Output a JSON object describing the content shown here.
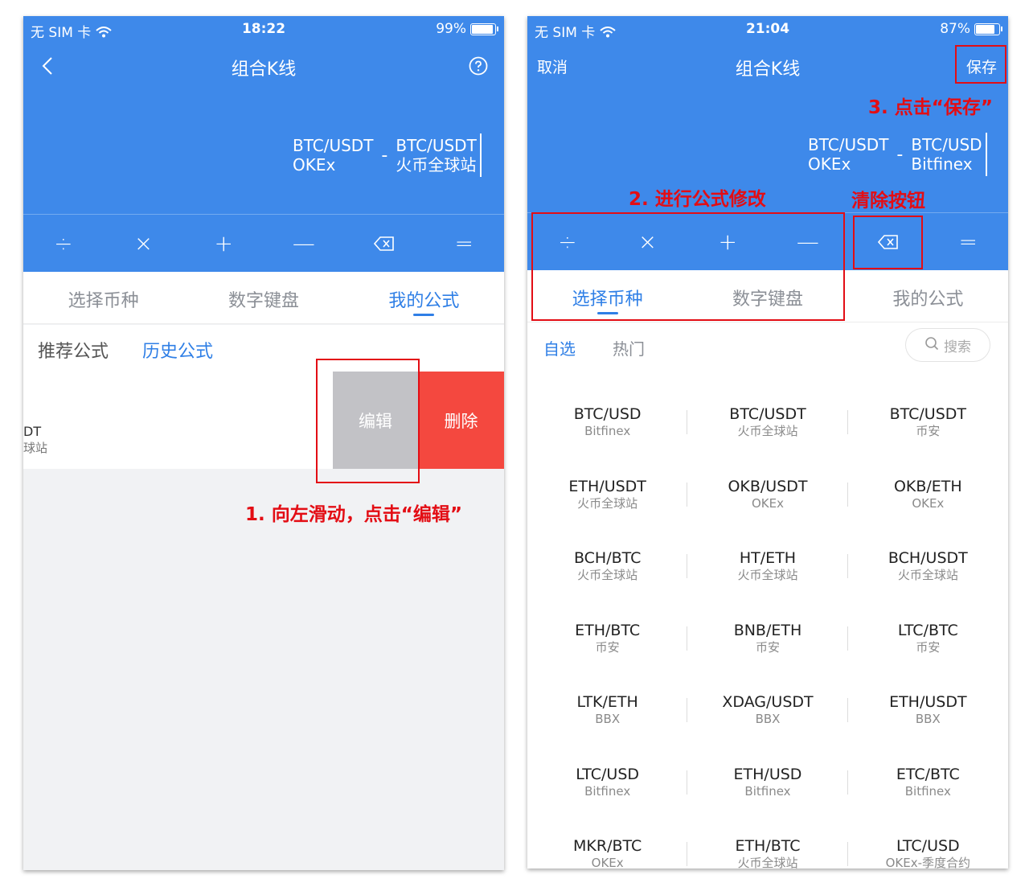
{
  "left": {
    "status": {
      "carrier": "无 SIM 卡",
      "time": "18:22",
      "battery": "99%",
      "battery_level": 0.99
    },
    "title": "组合K线",
    "pair_a": {
      "symbol": "BTC/USDT",
      "exchange": "OKEx"
    },
    "pair_b": {
      "symbol": "BTC/USDT",
      "exchange": "火币全球站"
    },
    "operator_between": "-",
    "ops": [
      "÷",
      "×",
      "+",
      "—",
      "⌫",
      "="
    ],
    "tabs": [
      "选择币种",
      "数字键盘",
      "我的公式"
    ],
    "subtabs": {
      "recommended": "推荐公式",
      "history": "历史公式"
    },
    "row_partial": {
      "line1": "DT",
      "line2": "球站"
    },
    "edit_label": "编辑",
    "delete_label": "删除",
    "annotation": "1. 向左滑动，点击“编辑”"
  },
  "right": {
    "status": {
      "carrier": "无 SIM 卡",
      "time": "21:04",
      "battery": "87%",
      "battery_level": 0.87
    },
    "cancel": "取消",
    "title": "组合K线",
    "save": "保存",
    "pair_a": {
      "symbol": "BTC/USDT",
      "exchange": "OKEx"
    },
    "pair_b": {
      "symbol": "BTC/USD",
      "exchange": "Bitfinex"
    },
    "operator_between": "-",
    "ops": [
      "÷",
      "×",
      "+",
      "—",
      "⌫",
      "="
    ],
    "tabs": [
      "选择币种",
      "数字键盘",
      "我的公式"
    ],
    "filters": {
      "favorites": "自选",
      "hot": "热门"
    },
    "search_placeholder": "搜索",
    "annotations": {
      "edit": "2. 进行公式修改",
      "clear": "清除按钮",
      "save": "3. 点击“保存”"
    },
    "grid": [
      {
        "pair": "BTC/USD",
        "exchange": "Bitfinex"
      },
      {
        "pair": "BTC/USDT",
        "exchange": "火币全球站"
      },
      {
        "pair": "BTC/USDT",
        "exchange": "币安"
      },
      {
        "pair": "ETH/USDT",
        "exchange": "火币全球站"
      },
      {
        "pair": "OKB/USDT",
        "exchange": "OKEx"
      },
      {
        "pair": "OKB/ETH",
        "exchange": "OKEx"
      },
      {
        "pair": "BCH/BTC",
        "exchange": "火币全球站"
      },
      {
        "pair": "HT/ETH",
        "exchange": "火币全球站"
      },
      {
        "pair": "BCH/USDT",
        "exchange": "火币全球站"
      },
      {
        "pair": "ETH/BTC",
        "exchange": "币安"
      },
      {
        "pair": "BNB/ETH",
        "exchange": "币安"
      },
      {
        "pair": "LTC/BTC",
        "exchange": "币安"
      },
      {
        "pair": "LTK/ETH",
        "exchange": "BBX"
      },
      {
        "pair": "XDAG/USDT",
        "exchange": "BBX"
      },
      {
        "pair": "ETH/USDT",
        "exchange": "BBX"
      },
      {
        "pair": "LTC/USD",
        "exchange": "Bitfinex"
      },
      {
        "pair": "ETH/USD",
        "exchange": "Bitfinex"
      },
      {
        "pair": "ETC/BTC",
        "exchange": "Bitfinex"
      },
      {
        "pair": "MKR/BTC",
        "exchange": "OKEx"
      },
      {
        "pair": "ETH/BTC",
        "exchange": "火币全球站"
      },
      {
        "pair": "LTC/USD",
        "exchange": "OKEx-季度合约"
      }
    ],
    "colors": {
      "primary_blue": "#3e89ea",
      "annotation_red": "#e30d14",
      "delete_red": "#f4483f"
    }
  }
}
